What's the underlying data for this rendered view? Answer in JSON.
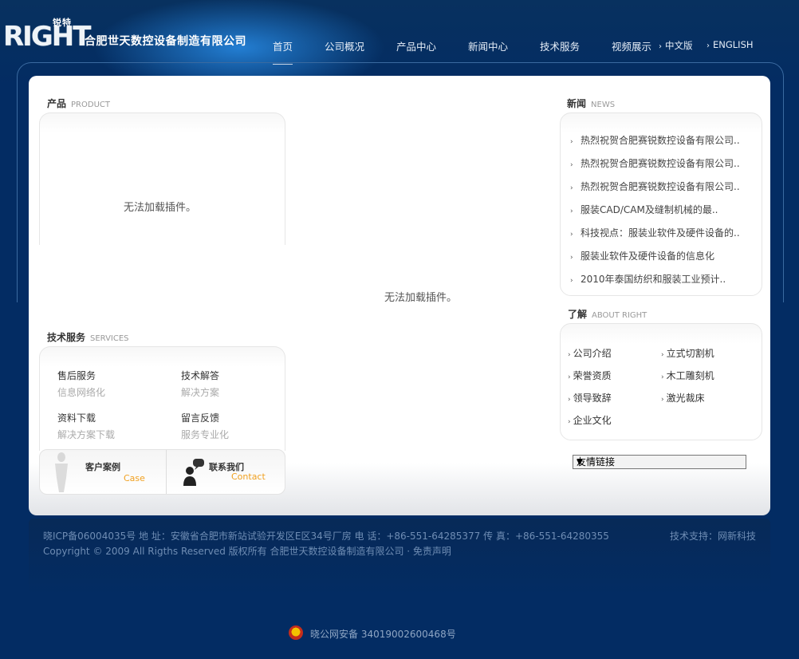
{
  "header": {
    "logo_mark": "RIGHT",
    "logo_small": "锐特",
    "company": "合肥世天数控设备制造有限公司",
    "nav": [
      "首页",
      "公司概况",
      "产品中心",
      "新闻中心",
      "技术服务",
      "视频展示"
    ],
    "lang": [
      "中文版",
      "ENGLISH"
    ]
  },
  "products": {
    "title": "产品",
    "title_en": "PRODUCT",
    "plugin_msg": "无法加载插件。"
  },
  "center": {
    "plugin_msg": "无法加载插件。"
  },
  "news": {
    "title": "新闻",
    "title_en": "NEWS",
    "items": [
      "热烈祝贺合肥赛锐数控设备有限公司..",
      "热烈祝贺合肥赛锐数控设备有限公司..",
      "热烈祝贺合肥赛锐数控设备有限公司..",
      "服装CAD/CAM及缝制机械的最..",
      "科技视点：服装业软件及硬件设备的..",
      "服装业软件及硬件设备的信息化",
      "2010年泰国纺织和服装工业预计.."
    ]
  },
  "about": {
    "title": "了解",
    "title_en": "ABOUT RIGHT",
    "col1": [
      "公司介绍",
      "荣誉资质",
      "领导致辞",
      "企业文化"
    ],
    "col2": [
      "立式切割机",
      "木工雕刻机",
      "激光裁床"
    ]
  },
  "services": {
    "title": "技术服务",
    "title_en": "SERVICES",
    "items": [
      {
        "title": "售后服务",
        "sub": "信息网络化"
      },
      {
        "title": "技术解答",
        "sub": "解决方案"
      },
      {
        "title": "资料下载",
        "sub": "解决方案下载"
      },
      {
        "title": "留言反馈",
        "sub": "服务专业化"
      }
    ]
  },
  "buttons": {
    "case_cn": "客户案例",
    "case_en": "Case",
    "contact_cn": "联系我们",
    "contact_en": "Contact"
  },
  "links_select": {
    "selected": "友情链接"
  },
  "footer": {
    "line1": "晓ICP备06004035号   地 址：安徽省合肥市新站试验开发区E区34号厂房   电 话：+86-551-64285377  传 真：+86-551-64280355",
    "tech_support": "技术支持：网新科技",
    "line2": "Copyright © 2009 All Rigths Reserved   版权所有  合肥世天数控设备制造有限公司   · 免责声明",
    "police": "晓公网安备 34019002600468号"
  }
}
